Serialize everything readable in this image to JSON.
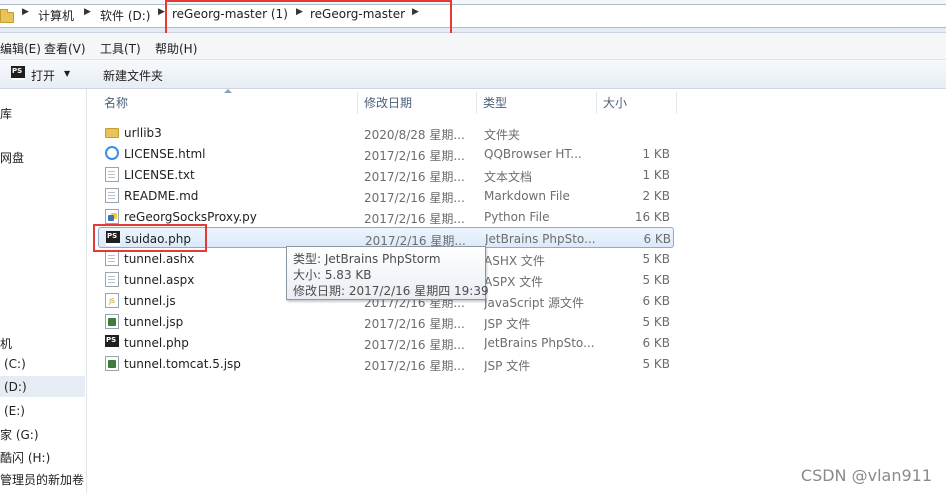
{
  "address_bar": {
    "crumbs": [
      "计算机",
      "软件 (D:)",
      "reGeorg-master (1)",
      "reGeorg-master"
    ],
    "separator": "▶"
  },
  "menu": [
    "编辑(E)",
    "查看(V)",
    "工具(T)",
    "帮助(H)"
  ],
  "toolbar": {
    "open_label": "打开",
    "open_dropdown": "▼",
    "new_folder_label": "新建文件夹"
  },
  "nav": {
    "items": [
      "库",
      "网盘",
      "机",
      "(C:)",
      "(D:)",
      "(E:)",
      "家 (G:)",
      "酷闪 (H:)",
      "管理员的新加卷"
    ]
  },
  "columns": {
    "name": "名称",
    "date": "修改日期",
    "type": "类型",
    "size": "大小"
  },
  "files": [
    {
      "icon": "folder-icon",
      "name": "urllib3",
      "date": "2020/8/28 星期...",
      "type": "文件夹",
      "size": ""
    },
    {
      "icon": "qqbrowser-icon",
      "name": "LICENSE.html",
      "date": "2017/2/16 星期...",
      "type": "QQBrowser HT...",
      "size": "1 KB"
    },
    {
      "icon": "text-file-icon",
      "name": "LICENSE.txt",
      "date": "2017/2/16 星期...",
      "type": "文本文档",
      "size": "1 KB"
    },
    {
      "icon": "markdown-file-icon",
      "name": "README.md",
      "date": "2017/2/16 星期...",
      "type": "Markdown File",
      "size": "2 KB"
    },
    {
      "icon": "python-file-icon",
      "name": "reGeorgSocksProxy.py",
      "date": "2017/2/16 星期...",
      "type": "Python File",
      "size": "16 KB"
    },
    {
      "icon": "phpstorm-file-icon",
      "name": "suidao.php",
      "date": "2017/2/16 星期...",
      "type": "JetBrains PhpSto...",
      "size": "6 KB"
    },
    {
      "icon": "file-icon",
      "name": "tunnel.ashx",
      "date": "",
      "type": "ASHX 文件",
      "size": "5 KB"
    },
    {
      "icon": "file-icon",
      "name": "tunnel.aspx",
      "date": "",
      "type": "ASPX 文件",
      "size": "5 KB"
    },
    {
      "icon": "js-file-icon",
      "name": "tunnel.js",
      "date": "2017/2/16 星期...",
      "type": "JavaScript 源文件",
      "size": "6 KB"
    },
    {
      "icon": "jsp-file-icon",
      "name": "tunnel.jsp",
      "date": "2017/2/16 星期...",
      "type": "JSP 文件",
      "size": "5 KB"
    },
    {
      "icon": "phpstorm-file-icon",
      "name": "tunnel.php",
      "date": "2017/2/16 星期...",
      "type": "JetBrains PhpSto...",
      "size": "6 KB"
    },
    {
      "icon": "jsp-file-icon",
      "name": "tunnel.tomcat.5.jsp",
      "date": "2017/2/16 星期...",
      "type": "JSP 文件",
      "size": "5 KB"
    }
  ],
  "tooltip": {
    "type_line": "类型: JetBrains PhpStorm",
    "size_line": "大小: 5.83 KB",
    "date_line": "修改日期: 2017/2/16 星期四 19:39"
  },
  "watermark": "CSDN @vlan911",
  "colors": {
    "highlight_box": "#e53935",
    "selection": "#dbe9fa"
  }
}
